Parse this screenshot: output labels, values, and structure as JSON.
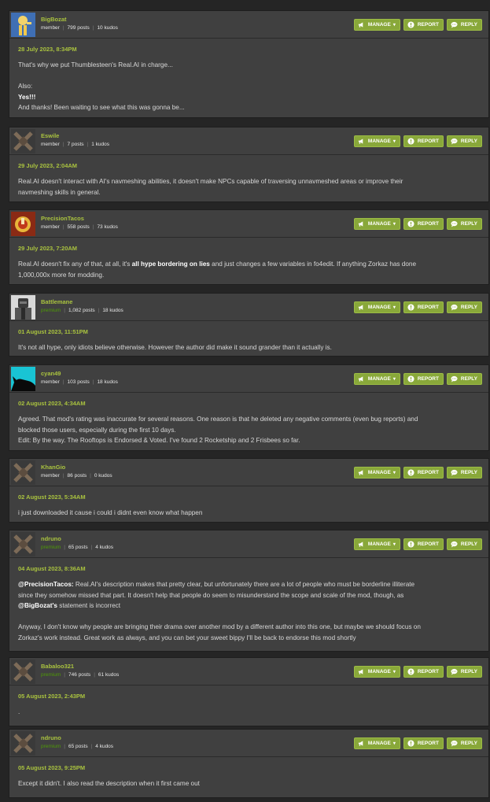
{
  "labels": {
    "manage": "MANAGE",
    "report": "REPORT",
    "reply": "REPLY"
  },
  "colors": {
    "accent": "#a9c23f",
    "button": "#89a83a",
    "premium_rank": "#4e9a06",
    "background": "#252525",
    "post_background": "#404040"
  },
  "posts": [
    {
      "author": "BigBozat",
      "rank": "member",
      "posts": "799 posts",
      "kudos": "10 kudos",
      "avatar_icon": "vault-boy-avatar-icon",
      "date": "28 July 2023, 8:34PM",
      "lines": [
        [
          "That's why we put Thumblesteen's Real.AI in charge..."
        ],
        [],
        [
          "Also:"
        ],
        [
          "",
          "Yes!!!"
        ],
        [
          "And thanks!  Been waiting to see what this was gonna be..."
        ]
      ]
    },
    {
      "author": "Eswile",
      "rank": "member",
      "posts": "7 posts",
      "kudos": "1 kudos",
      "avatar_icon": "default-avatar-icon",
      "date": "29 July 2023, 2:04AM",
      "lines": [
        [
          "Real.AI doesn't interact with AI's navmeshing abilities, it doesn't make NPCs capable of traversing unnavmeshed areas or improve their"
        ],
        [
          "navmeshing skills in general."
        ]
      ]
    },
    {
      "author": "PrecisionTacos",
      "rank": "member",
      "posts": "558 posts",
      "kudos": "73 kudos",
      "avatar_icon": "taco-helmet-avatar-icon",
      "date": "29 July 2023, 7:20AM",
      "lines": [
        [
          "Real.AI doesn't fix any of that, at all, it's ",
          "all hype bordering on lies",
          " and just changes a few variables in fo4edit. If anything Zorkaz has done"
        ],
        [
          "1,000,000x more for modding."
        ]
      ]
    },
    {
      "author": "Battlemane",
      "rank": "premium",
      "posts": "1,082 posts",
      "kudos": "18 kudos",
      "avatar_icon": "power-armor-avatar-icon",
      "date": "01 August 2023, 11:51PM",
      "lines": [
        [
          "It's not all hype, only idiots believe otherwise. However the author did make it sound grander than it actually is."
        ]
      ]
    },
    {
      "author": "cyan49",
      "rank": "member",
      "posts": "103 posts",
      "kudos": "18 kudos",
      "avatar_icon": "creature-silhouette-avatar-icon",
      "date": "02 August 2023, 4:34AM",
      "lines": [
        [
          "Agreed. That mod's rating was inaccurate for several reasons. One reason is that he deleted any negative comments (even bug reports) and"
        ],
        [
          "blocked those users, especially during the first 10 days."
        ],
        [
          "Edit: By the way. The Rooftops is Endorsed & Voted. I've found 2 Rocketship and 2 Frisbees so far."
        ]
      ]
    },
    {
      "author": "KhanGio",
      "rank": "member",
      "posts": "86 posts",
      "kudos": "0 kudos",
      "avatar_icon": "default-avatar-icon",
      "date": "02 August 2023, 5:34AM",
      "lines": [
        [
          "i just downloaded it cause i could i didnt even know what happen"
        ]
      ]
    },
    {
      "author": "ndruno",
      "rank": "premium",
      "posts": "65 posts",
      "kudos": "4 kudos",
      "avatar_icon": "default-avatar-icon",
      "date": "04 August 2023, 8:36AM",
      "lines": [
        [
          "",
          "@PrecisionTacos:",
          " Real.AI's description makes that pretty clear, but unfortunately there are a lot of people who must be borderline illiterate"
        ],
        [
          "since they somehow missed that part. It doesn't help that people do seem to misunderstand the scope and scale of the mod, though, as"
        ],
        [
          "",
          "@BigBozat's",
          " statement is incorrect"
        ],
        [],
        [
          "Anyway, I don't know why people are bringing their drama over another mod by a different author into this one, but maybe we should focus on"
        ],
        [
          "Zorkaz's work instead. Great work as always, and you can bet your sweet bippy I'll be back to endorse this mod shortly"
        ]
      ]
    },
    {
      "author": "Babaloo321",
      "rank": "premium",
      "posts": "746 posts",
      "kudos": "61 kudos",
      "avatar_icon": "default-avatar-icon",
      "date": "05 August 2023, 2:43PM",
      "lines": [
        [
          "."
        ]
      ]
    },
    {
      "author": "ndruno",
      "rank": "premium",
      "posts": "65 posts",
      "kudos": "4 kudos",
      "avatar_icon": "default-avatar-icon",
      "date": "05 August 2023, 9:25PM",
      "lines": [
        [
          "Except it didn't. I also read the description when it first came out"
        ]
      ]
    }
  ]
}
